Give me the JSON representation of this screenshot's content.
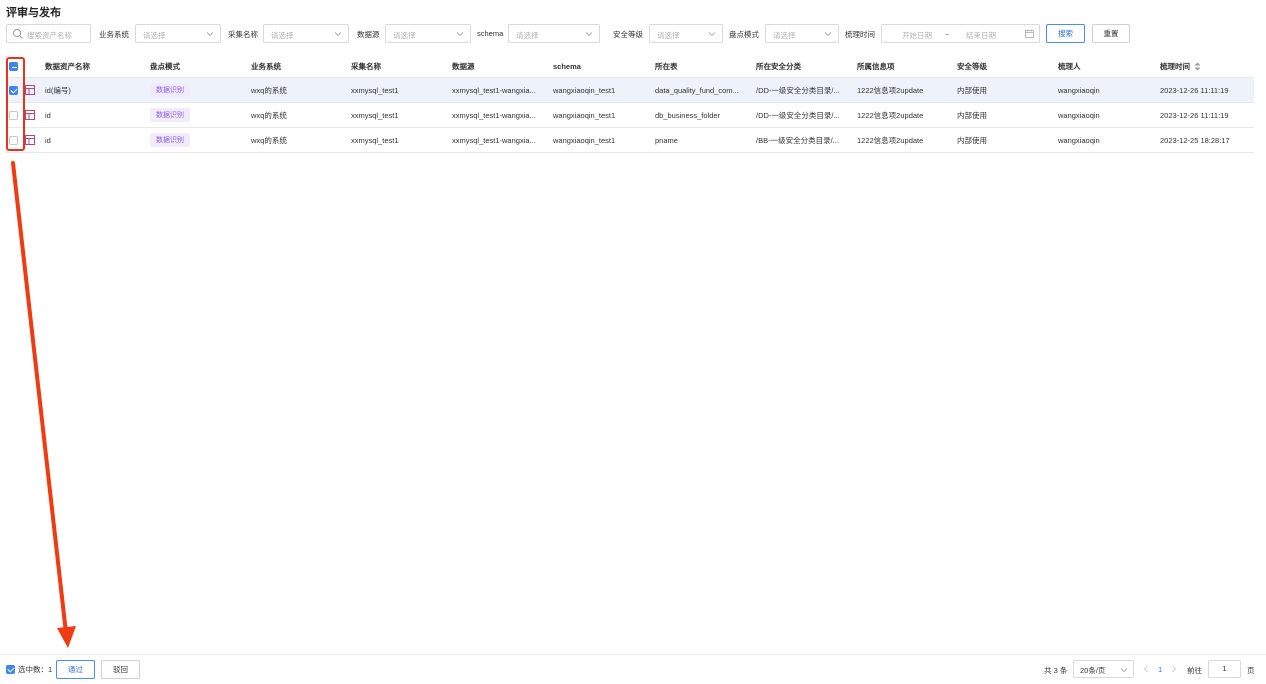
{
  "page_title": "评审与发布",
  "filters": {
    "search_placeholder": "搜索资产名称",
    "select_placeholder": "请选择",
    "labels": {
      "business_system": "业务系统",
      "collect_name": "采集名称",
      "datasource": "数据源",
      "schema": "schema",
      "security_level": "安全等级",
      "inventory_mode": "盘点模式",
      "sort_time": "梳理时间"
    },
    "date_start_placeholder": "开始日期",
    "date_sep": "~",
    "date_end_placeholder": "结束日期",
    "search_button": "搜索",
    "reset_button": "重置"
  },
  "table": {
    "headers": [
      "数据资产名称",
      "盘点模式",
      "业务系统",
      "采集名称",
      "数据源",
      "schema",
      "所在表",
      "所在安全分类",
      "所属信息项",
      "安全等级",
      "梳理人",
      "梳理时间"
    ],
    "rows": [
      {
        "selected": true,
        "name": "id(编号)",
        "mode": "数据识别",
        "system": "wxq的系统",
        "collect": "xxmysql_test1",
        "datasource": "xxmysql_test1-wangxia...",
        "schema": "wangxiaoqin_test1",
        "table": "data_quality_fund_com...",
        "category": "/DD-一级安全分类目录/...",
        "info_item": "1222信息项2update",
        "level": "内部使用",
        "owner": "wangxiaoqin",
        "time": "2023-12-26 11:11:19"
      },
      {
        "selected": false,
        "name": "id",
        "mode": "数据识别",
        "system": "wxq的系统",
        "collect": "xxmysql_test1",
        "datasource": "xxmysql_test1-wangxia...",
        "schema": "wangxiaoqin_test1",
        "table": "db_business_folder",
        "category": "/DD-一级安全分类目录/...",
        "info_item": "1222信息项2update",
        "level": "内部使用",
        "owner": "wangxiaoqin",
        "time": "2023-12-26 11:11:19"
      },
      {
        "selected": false,
        "name": "id",
        "mode": "数据识别",
        "system": "wxq的系统",
        "collect": "xxmysql_test1",
        "datasource": "xxmysql_test1-wangxia...",
        "schema": "wangxiaoqin_test1",
        "table": "pname",
        "category": "/BB-一级安全分类目录/...",
        "info_item": "1222信息项2update",
        "level": "内部使用",
        "owner": "wangxiaoqin",
        "time": "2023-12-25 18:28:17"
      }
    ]
  },
  "footer": {
    "selected_count_label": "选中数：1",
    "approve_button": "通过",
    "reject_button": "驳回",
    "total_label": "共 3 条",
    "page_size": "20条/页",
    "current_page": "1",
    "goto_label": "前往",
    "goto_value": "1",
    "page_unit": "页"
  },
  "colors": {
    "accent": "#3d86f0",
    "annotation_red": "#e8341c",
    "tag_purple": "#8a5cf0",
    "selected_row": "#eef2fb"
  }
}
